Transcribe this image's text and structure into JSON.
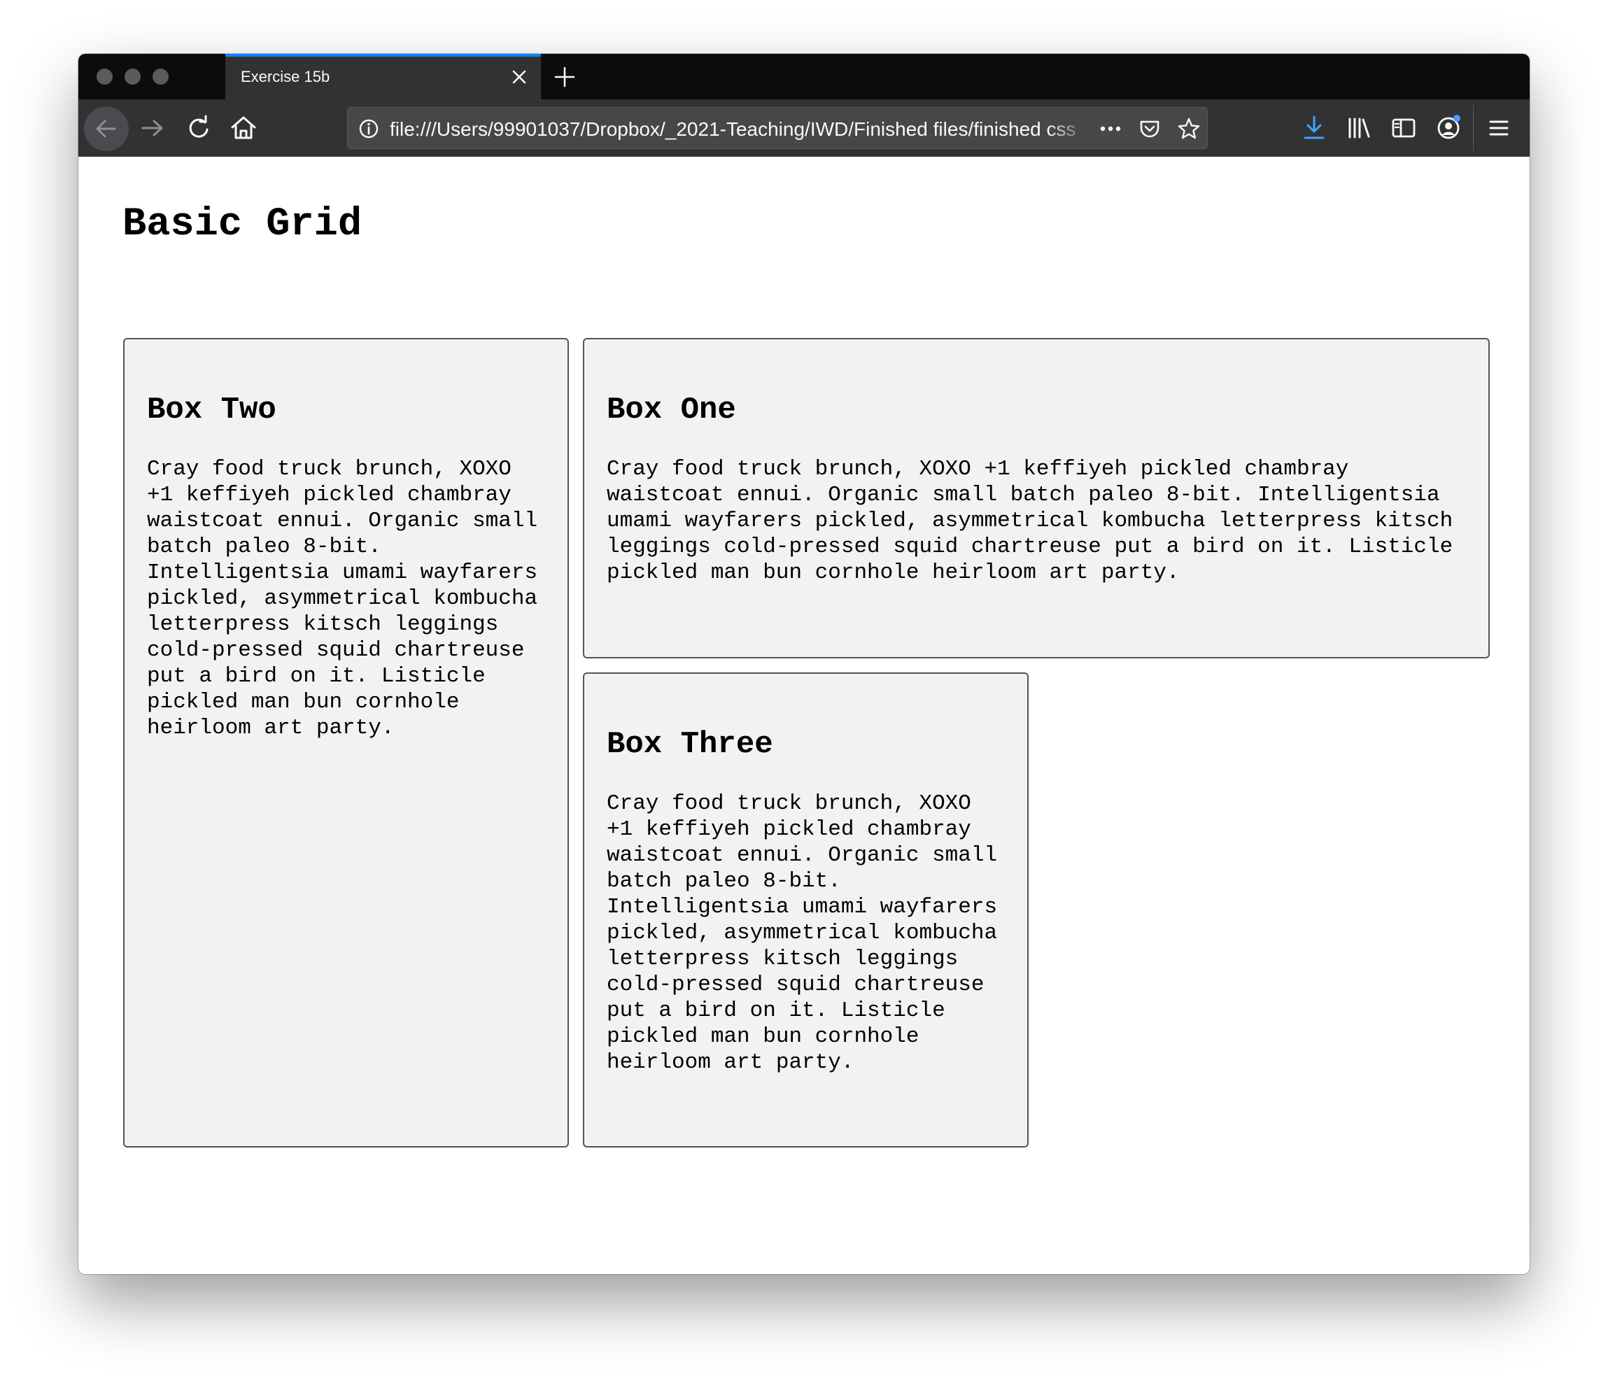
{
  "browser": {
    "tab_title": "Exercise 15b",
    "url": "file:///Users/99901037/Dropbox/_2021-Teaching/IWD/Finished files/finished css"
  },
  "page": {
    "title": "Basic Grid",
    "boxes": [
      {
        "heading": "Box Two",
        "text": "Cray food truck brunch, XOXO +1 keffiyeh pickled chambray waistcoat ennui. Organic small batch paleo 8-bit. Intelligentsia umami wayfarers pickled, asymmetrical kombucha letterpress kitsch leggings cold-pressed squid chartreuse put a bird on it. Listicle pickled man bun cornhole heirloom art party."
      },
      {
        "heading": "Box One",
        "text": "Cray food truck brunch, XOXO +1 keffiyeh pickled chambray waistcoat ennui. Organic small batch paleo 8-bit. Intelligentsia umami wayfarers pickled, asymmetrical kombucha letterpress kitsch leggings cold-pressed squid chartreuse put a bird on it. Listicle pickled man bun cornhole heirloom art party."
      },
      {
        "heading": "Box Three",
        "text": "Cray food truck brunch, XOXO +1 keffiyeh pickled chambray waistcoat ennui. Organic small batch paleo 8-bit. Intelligentsia umami wayfarers pickled, asymmetrical kombucha letterpress kitsch leggings cold-pressed squid chartreuse put a bird on it. Listicle pickled man bun cornhole heirloom art party."
      }
    ]
  }
}
